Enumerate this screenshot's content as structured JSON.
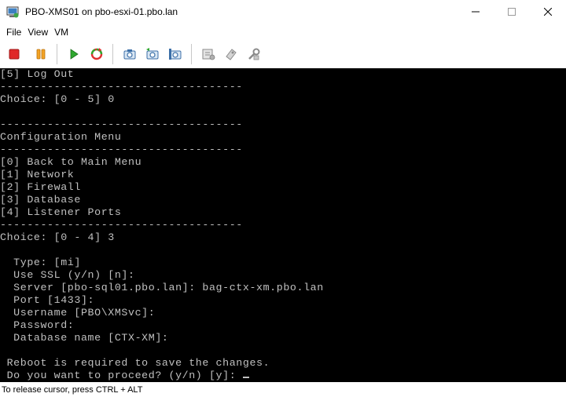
{
  "window": {
    "title": "PBO-XMS01 on pbo-esxi-01.pbo.lan"
  },
  "menu": {
    "items": [
      "File",
      "View",
      "VM"
    ]
  },
  "toolbar": {
    "icons": [
      "stop-icon",
      "pause-icon",
      "play-icon",
      "reset-icon",
      "snapshot-icon",
      "snapshot-revert-icon",
      "snapshot-manager-icon",
      "vm-settings-icon",
      "device-icon",
      "tools-icon"
    ],
    "colors": {
      "stop": "#d9262a",
      "pause": "#f0a020",
      "play": "#2a9a2a",
      "reset": "#e03030"
    }
  },
  "console": {
    "lines": [
      "[5] Log Out",
      "------------------------------------",
      "Choice: [0 - 5] 0",
      "",
      "------------------------------------",
      "Configuration Menu",
      "------------------------------------",
      "[0] Back to Main Menu",
      "[1] Network",
      "[2] Firewall",
      "[3] Database",
      "[4] Listener Ports",
      "------------------------------------",
      "Choice: [0 - 4] 3",
      "",
      "  Type: [mi]",
      "  Use SSL (y/n) [n]:",
      "  Server [pbo-sql01.pbo.lan]: bag-ctx-xm.pbo.lan",
      "  Port [1433]:",
      "  Username [PBO\\XMSvc]:",
      "  Password:",
      "  Database name [CTX-XM]:",
      "",
      " Reboot is required to save the changes.",
      " Do you want to proceed? (y/n) [y]: "
    ]
  },
  "status": {
    "text": "To release cursor, press CTRL + ALT"
  }
}
